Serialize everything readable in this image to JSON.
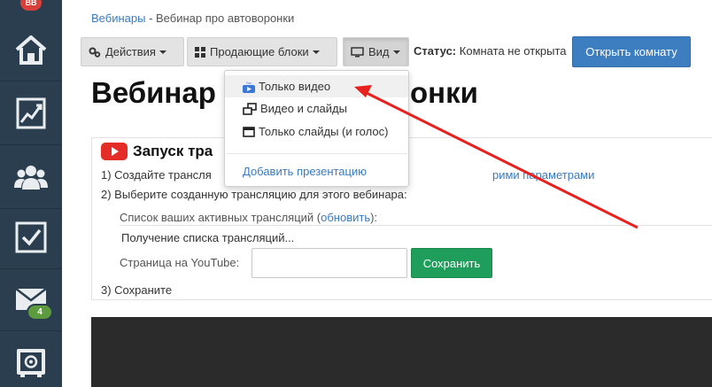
{
  "sidebar": {
    "top_badge": "BB",
    "items": [
      {
        "icon": "home-icon"
      },
      {
        "icon": "chart-icon"
      },
      {
        "icon": "users-icon"
      },
      {
        "icon": "checkbox-icon"
      },
      {
        "icon": "mail-icon",
        "badge": "4"
      },
      {
        "icon": "safe-icon"
      }
    ]
  },
  "breadcrumb": {
    "parent": "Вебинары",
    "separator": " - ",
    "current": "Вебинар про автоворонки"
  },
  "toolbar": {
    "actions_label": "Действия",
    "blocks_label": "Продающие блоки",
    "view_label": "Вид",
    "status_label": "Статус:",
    "status_value": "Комната не открыта",
    "open_room_label": "Открыть комнату"
  },
  "page": {
    "title_left": "Вебинар",
    "title_right": "онки"
  },
  "view_menu": {
    "items": [
      {
        "label": "Только видео",
        "icon": "youtube-small-icon",
        "active": true
      },
      {
        "label": "Видео и слайды",
        "icon": "video-slides-icon"
      },
      {
        "label": "Только слайды (и голос)",
        "icon": "slides-icon"
      }
    ],
    "add_presentation": "Добавить презентацию"
  },
  "broadcast": {
    "heading": "Запуск тра",
    "step1_prefix": "1) Создайте трансля",
    "step1_link": "рими параметрами",
    "step2": "2) Выберите созданную трансляцию для этого вебинара:",
    "active_list_label": "Список ваших активных трансляций (",
    "refresh_link": "обновить",
    "active_list_suffix": "):",
    "loading": "Получение списка трансляций...",
    "youtube_page_label": "Страница на YouTube:",
    "youtube_input_value": "",
    "save_label": "Сохранить",
    "step3": "3) Сохраните"
  },
  "colors": {
    "sidebar": "#2a3e50",
    "primary_button": "#3d7ec1",
    "save_button": "#1f9d5b",
    "link": "#3a7bbf",
    "arrow": "#e8211f"
  }
}
